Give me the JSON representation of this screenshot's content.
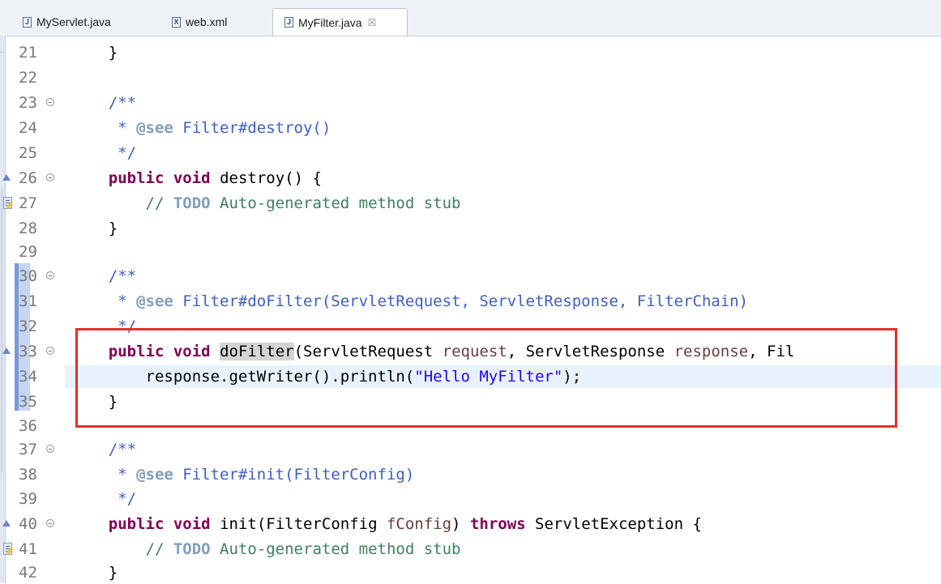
{
  "tabs": [
    {
      "label": "MyServlet.java",
      "icon": "java-file-icon",
      "active": false
    },
    {
      "label": "web.xml",
      "icon": "xml-file-icon",
      "active": false
    },
    {
      "label": "MyFilter.java",
      "icon": "java-file-icon",
      "active": true,
      "close": "☒"
    }
  ],
  "editor": {
    "lines": [
      {
        "n": "21",
        "code": "    }"
      },
      {
        "n": "22",
        "code": ""
      },
      {
        "n": "23",
        "code": "    /**"
      },
      {
        "n": "24",
        "code": "     * @see Filter#destroy()"
      },
      {
        "n": "25",
        "code": "     */"
      },
      {
        "n": "26",
        "code": "    public void destroy() {"
      },
      {
        "n": "27",
        "code": "        // TODO Auto-generated method stub"
      },
      {
        "n": "28",
        "code": "    }"
      },
      {
        "n": "29",
        "code": ""
      },
      {
        "n": "30",
        "code": "    /**"
      },
      {
        "n": "31",
        "code": "     * @see Filter#doFilter(ServletRequest, ServletResponse, FilterChain)"
      },
      {
        "n": "32",
        "code": "     */"
      },
      {
        "n": "33",
        "code": "    public void doFilter(ServletRequest request, ServletResponse response, Fil"
      },
      {
        "n": "34",
        "code": "        response.getWriter().println(\"Hello MyFilter\");"
      },
      {
        "n": "35",
        "code": "    }"
      },
      {
        "n": "36",
        "code": ""
      },
      {
        "n": "37",
        "code": "    /**"
      },
      {
        "n": "38",
        "code": "     * @see Filter#init(FilterConfig)"
      },
      {
        "n": "39",
        "code": "     */"
      },
      {
        "n": "40",
        "code": "    public void init(FilterConfig fConfig) throws ServletException {"
      },
      {
        "n": "41",
        "code": "        // TODO Auto-generated method stub"
      },
      {
        "n": "42",
        "code": "    }"
      }
    ]
  },
  "colors": {
    "keyword": "#7f0055",
    "comment": "#3f5fbf",
    "line_comment": "#3f7f5f",
    "string": "#2a00ff",
    "highlight_box": "#e03131",
    "current_line": "#e8f2fe"
  }
}
